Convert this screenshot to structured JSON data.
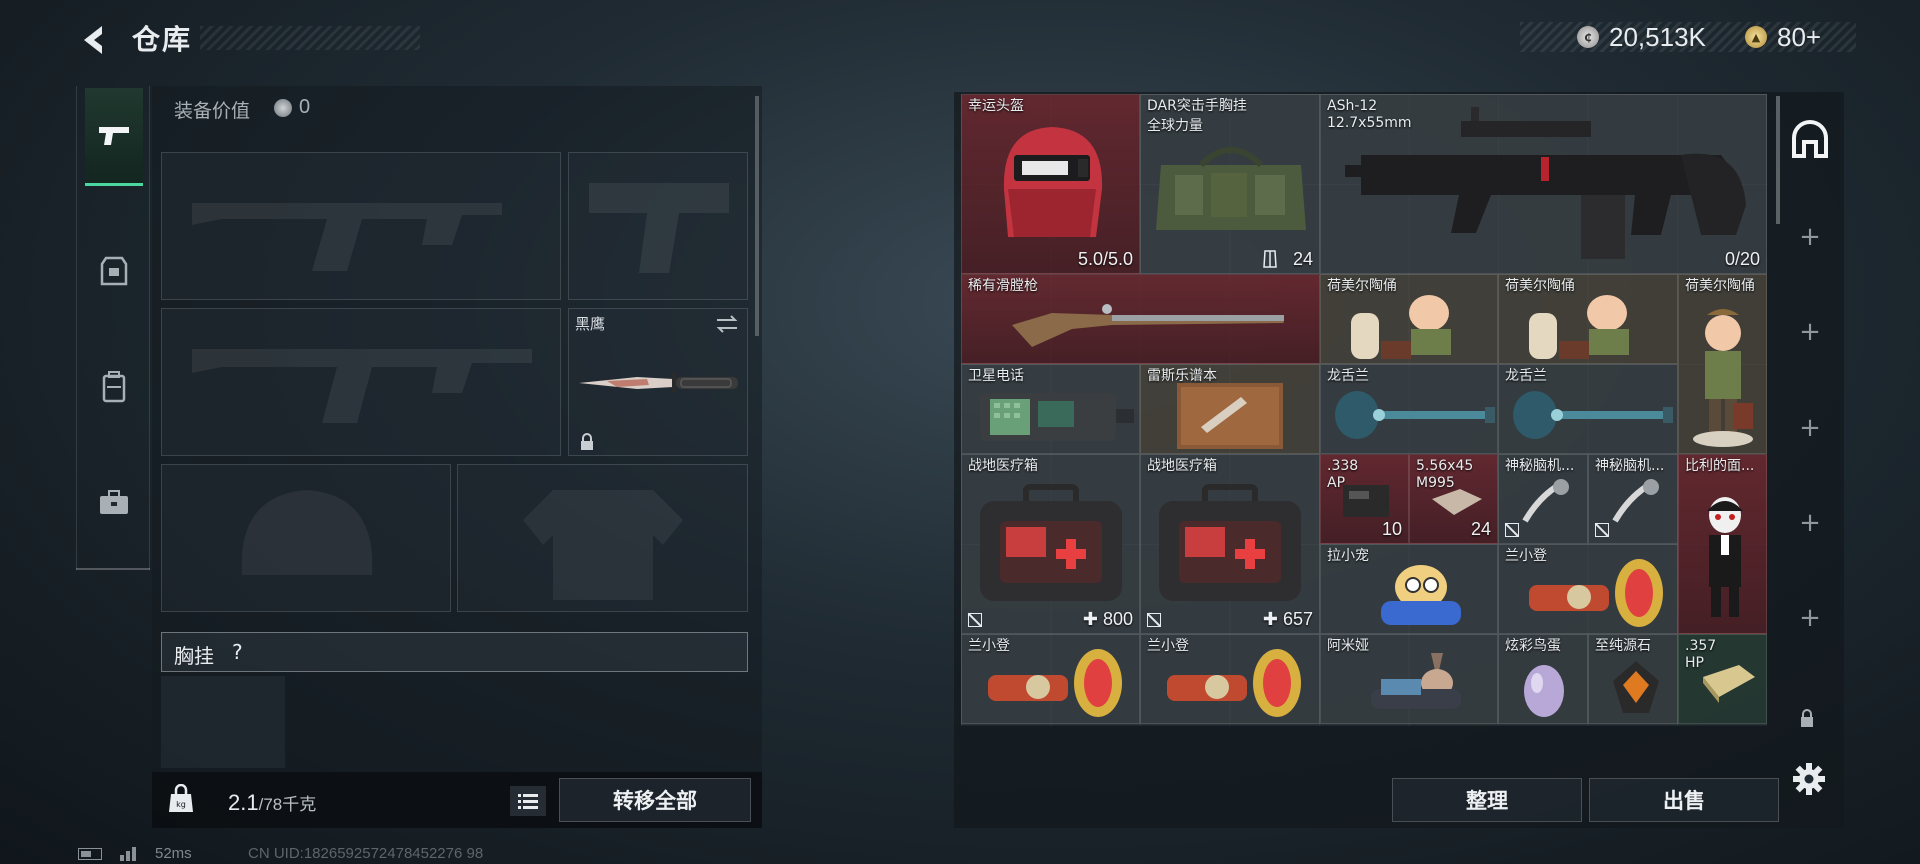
{
  "header": {
    "title": "仓库",
    "silver_amount": "20,513K",
    "gold_amount": "80+"
  },
  "equipment": {
    "value_label": "装备价值",
    "value": "0",
    "melee_name": "黑鹰",
    "chest_rig_label": "胸挂",
    "help_label": "?"
  },
  "weight": {
    "current": "2.1",
    "max": "/78千克",
    "transfer_all": "转移全部"
  },
  "status": {
    "ping": "52ms",
    "uid": "CN UID:1826592572478452276 98"
  },
  "inventory": {
    "items": [
      {
        "name": "幸运头盔",
        "count": "5.0/5.0"
      },
      {
        "name": "DAR突击手胸挂",
        "sub": "全球力量",
        "count": "24"
      },
      {
        "name": "ASh-12",
        "sub": "12.7x55mm",
        "count": "0/20"
      },
      {
        "name": "稀有滑膛枪"
      },
      {
        "name": "荷美尔陶俑"
      },
      {
        "name": "荷美尔陶俑"
      },
      {
        "name": "荷美尔陶俑"
      },
      {
        "name": "卫星电话"
      },
      {
        "name": "雷斯乐谱本"
      },
      {
        "name": "龙舌兰"
      },
      {
        "name": "龙舌兰"
      },
      {
        "name": "战地医疗箱",
        "count": "800"
      },
      {
        "name": "战地医疗箱",
        "count": "657"
      },
      {
        "name": ".338",
        "sub": "AP",
        "count": "10"
      },
      {
        "name": "5.56x45",
        "sub": "M995",
        "count": "24"
      },
      {
        "name": "神秘脑机..."
      },
      {
        "name": "神秘脑机..."
      },
      {
        "name": "比利的面..."
      },
      {
        "name": "拉小宠"
      },
      {
        "name": "兰小登"
      },
      {
        "name": "兰小登"
      },
      {
        "name": "兰小登"
      },
      {
        "name": "阿米娅"
      },
      {
        "name": "炫彩鸟蛋"
      },
      {
        "name": "至纯源石"
      },
      {
        "name": ".357",
        "sub": "HP"
      }
    ]
  },
  "buttons": {
    "sort": "整理",
    "sell": "出售"
  },
  "colors": {
    "accent": "#4ad8a0",
    "rare_red": "#782830",
    "panel": "#141b21"
  }
}
